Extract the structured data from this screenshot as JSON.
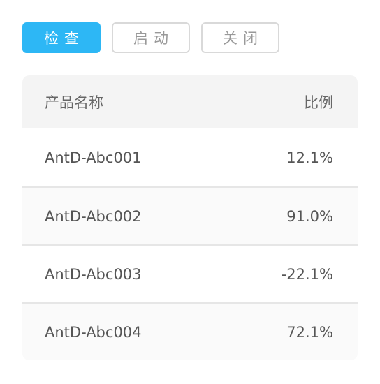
{
  "toolbar": {
    "buttons": [
      {
        "label": "检查"
      },
      {
        "label": "启动"
      },
      {
        "label": "关闭"
      }
    ]
  },
  "table": {
    "headers": {
      "name": "产品名称",
      "ratio": "比例"
    },
    "rows": [
      {
        "name": "AntD-Abc001",
        "ratio": "12.1%"
      },
      {
        "name": "AntD-Abc002",
        "ratio": "91.0%"
      },
      {
        "name": "AntD-Abc003",
        "ratio": "-22.1%"
      },
      {
        "name": "AntD-Abc004",
        "ratio": "72.1%"
      }
    ]
  },
  "colors": {
    "primary": "#2db7f5",
    "header_bg": "#f4f4f4",
    "border": "#d9d9d9"
  }
}
